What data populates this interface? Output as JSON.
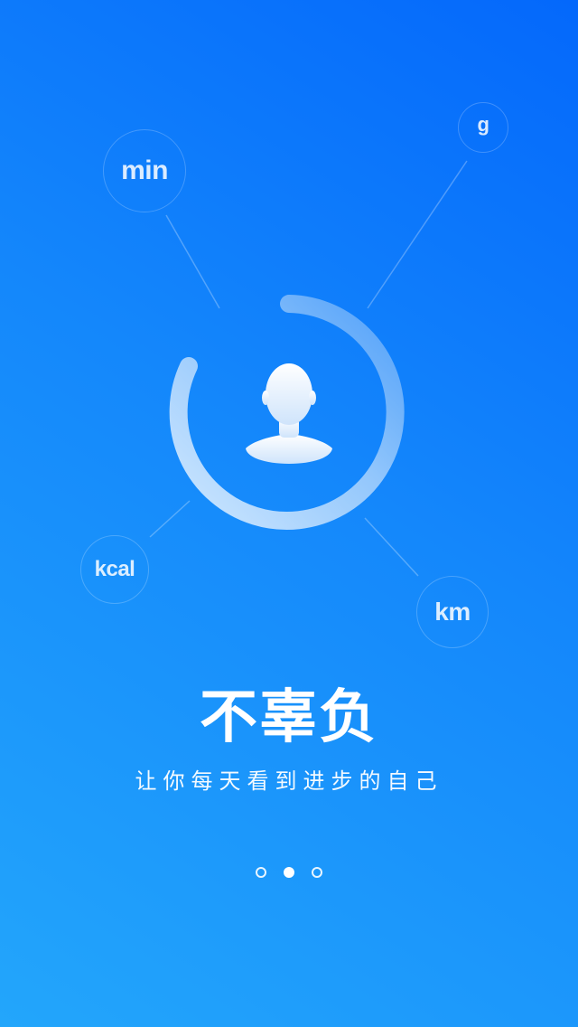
{
  "onboarding": {
    "units": {
      "min": "min",
      "g": "g",
      "kcal": "kcal",
      "km": "km"
    },
    "title": "不辜负",
    "subtitle": "让你每天看到进步的自己",
    "pager": {
      "total_pages": 3,
      "current_page": 2
    },
    "progress_ring": {
      "fill_fraction": 0.88
    }
  },
  "colors": {
    "background_top": "#0468fb",
    "background_bottom": "#23a6fb",
    "text": "#ffffff"
  }
}
